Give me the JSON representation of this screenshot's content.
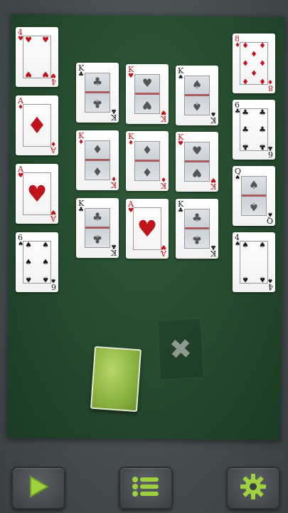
{
  "colors": {
    "felt": "#2a5233",
    "red": "#c0141c",
    "black": "#1a1a1a",
    "accent": "#9ed13d"
  },
  "cards": {
    "left_1": {
      "rank": "4",
      "suit": "♥",
      "color": "red"
    },
    "left_2": {
      "rank": "A",
      "suit": "♦",
      "color": "red"
    },
    "left_3": {
      "rank": "A",
      "suit": "♥",
      "color": "red"
    },
    "left_4": {
      "rank": "6",
      "suit": "♠",
      "color": "black"
    },
    "mid_1": {
      "rank": "K",
      "suit": "♣",
      "color": "black"
    },
    "mid_2": {
      "rank": "K",
      "suit": "♥",
      "color": "red"
    },
    "mid_3": {
      "rank": "K",
      "suit": "♠",
      "color": "black"
    },
    "mid_4": {
      "rank": "K",
      "suit": "♦",
      "color": "red"
    },
    "mid_5": {
      "rank": "K",
      "suit": "♦",
      "color": "red"
    },
    "mid_6": {
      "rank": "K",
      "suit": "♥",
      "color": "red"
    },
    "mid_7": {
      "rank": "K",
      "suit": "♣",
      "color": "black"
    },
    "mid_8": {
      "rank": "A",
      "suit": "♥",
      "color": "red"
    },
    "mid_9": {
      "rank": "K",
      "suit": "♣",
      "color": "black"
    },
    "right_1": {
      "rank": "8",
      "suit": "♦",
      "color": "red"
    },
    "right_2": {
      "rank": "6",
      "suit": "♣",
      "color": "black"
    },
    "right_3": {
      "rank": "Q",
      "suit": "♠",
      "color": "black"
    },
    "right_4": {
      "rank": "4",
      "suit": "♠",
      "color": "black"
    }
  },
  "toolbar": {
    "play_icon": "play-icon",
    "menu_icon": "menu-list-icon",
    "settings_icon": "gear-icon"
  },
  "waste": {
    "symbol": "✖"
  }
}
